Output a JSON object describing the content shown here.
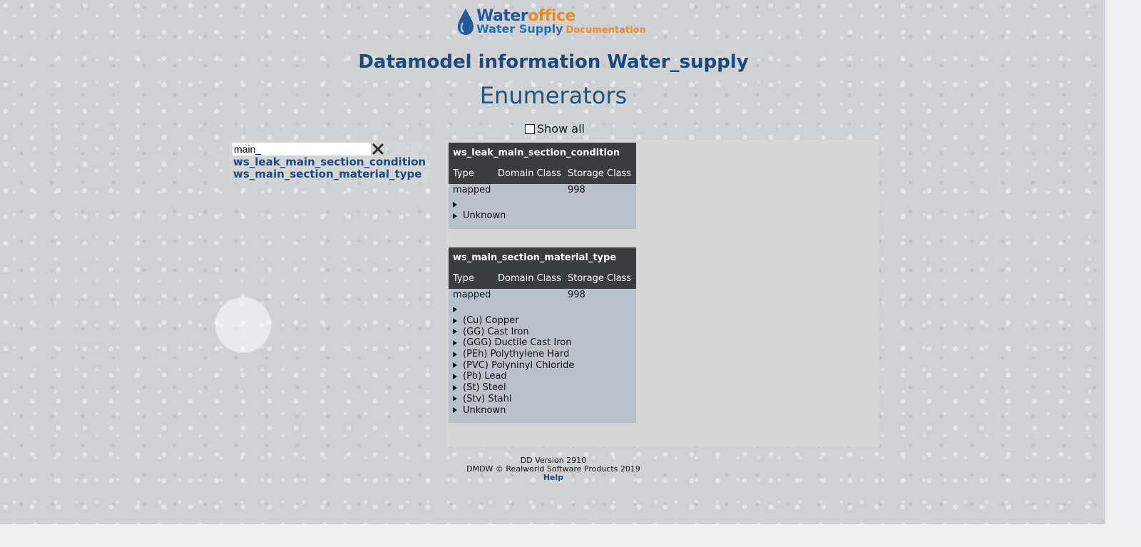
{
  "logo": {
    "word1": "Water",
    "word2": "office",
    "line2_part1": "Water Supply",
    "line2_part2": "Documentation",
    "icon": "water-drop-icon"
  },
  "header": {
    "title": "Datamodel information Water_supply",
    "subtitle": "Enumerators"
  },
  "show_all": {
    "label": "Show all",
    "checked": false
  },
  "search": {
    "value": "main_",
    "clear_icon": "close-icon",
    "results": [
      "ws_leak_main_section_condition",
      "ws_main_section_material_type"
    ]
  },
  "enums": [
    {
      "name": "ws_leak_main_section_condition",
      "columns": [
        "Type",
        "Domain Class",
        "Storage Class"
      ],
      "type": "mapped",
      "domain_class": "",
      "storage_class": "998",
      "items": [
        "",
        "Unknown"
      ]
    },
    {
      "name": "ws_main_section_material_type",
      "columns": [
        "Type",
        "Domain Class",
        "Storage Class"
      ],
      "type": "mapped",
      "domain_class": "",
      "storage_class": "998",
      "items": [
        "",
        "(Cu) Copper",
        "(GG) Cast Iron",
        "(GGG) Ductile Cast Iron",
        "(PEh) Polythylene Hard",
        "(PVC) Polyninyl Chloride",
        "(Pb) Lead",
        "(St) Steel",
        "(Stv) Stahl",
        "Unknown"
      ]
    }
  ],
  "footer": {
    "version": "DD Version 2910",
    "copyright": "DMDW © Realworld Software Products 2019",
    "help": "Help"
  }
}
